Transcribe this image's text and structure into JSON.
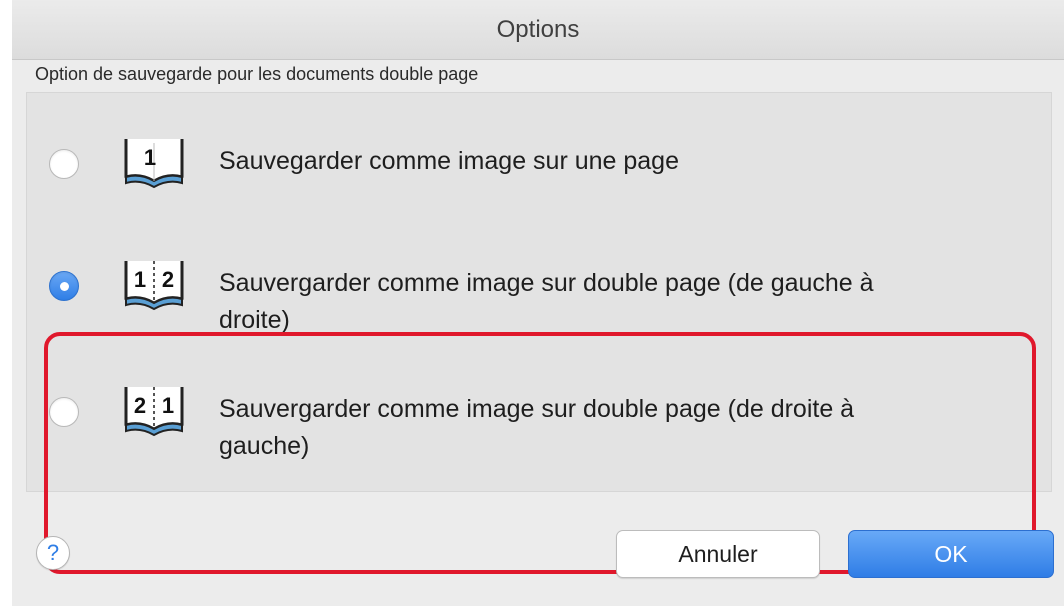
{
  "window": {
    "title": "Options"
  },
  "group": {
    "label": "Option de sauvegarde pour les documents double page",
    "options": [
      {
        "icon": "single-page-book-icon",
        "icon_text": [
          "1"
        ],
        "line1": "Sauvegarder comme image sur une page",
        "line2": "",
        "selected": false
      },
      {
        "icon": "left-to-right-book-icon",
        "icon_text": [
          "1",
          "2"
        ],
        "line1": "Sauvergarder comme image sur double page (de gauche à",
        "line2": "droite)",
        "selected": true
      },
      {
        "icon": "right-to-left-book-icon",
        "icon_text": [
          "2",
          "1"
        ],
        "line1": "Sauvergarder comme image sur double page (de droite à",
        "line2": "gauche)",
        "selected": false
      }
    ]
  },
  "footer": {
    "help": "?",
    "cancel": "Annuler",
    "ok": "OK"
  },
  "colors": {
    "accent": "#2f7ee6",
    "highlight": "#e0182c"
  }
}
